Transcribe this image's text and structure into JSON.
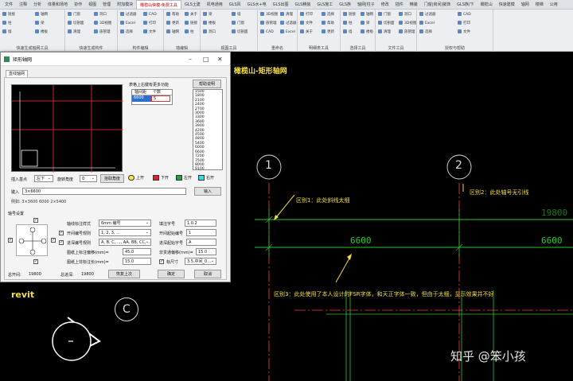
{
  "ribbon": {
    "tabs": [
      "文件",
      "注释",
      "分析",
      "体量和场地",
      "协作",
      "视图",
      "管理",
      "附加模块",
      "橄榄山快模-免费工具",
      "GLS土建",
      "机电通用",
      "GLS风",
      "GLS水+电",
      "GLS出图",
      "GLS精装",
      "GLS施工",
      "GLS族",
      "轴网|柱子",
      "修改",
      "插件",
      "精装",
      "门窗|房间|装饰",
      "GLS族/下",
      "橄榄山",
      "快速建模",
      "轴网",
      "楼梯",
      "公用"
    ],
    "active_tab": "橄榄山快模-免费工具",
    "panels": [
      "快速生成轴网工具",
      "快速生成构件",
      "构件编辑",
      "墙编辑",
      "视图工具",
      "重命名",
      "明细表工具",
      "选择工具",
      "文件工具",
      "授权与帮助"
    ],
    "buttons": [
      "链接",
      "轴网",
      "柱",
      "梁",
      "墙",
      "楼板",
      "门窗",
      "洞口",
      "切剖面",
      "3D视图",
      "清理",
      "族管理",
      "过滤器",
      "CAD",
      "Excel",
      "打印",
      "选择",
      "文件",
      "帮助",
      "关于",
      "更新"
    ]
  },
  "dialog": {
    "title": "矩形轴网",
    "tab": "直线轴网",
    "hint": "表格上右键有更多功能",
    "help_button": "帮助说明",
    "table_headers": [
      "轴间距",
      "个数"
    ],
    "table_row": [
      "6600",
      "5"
    ],
    "spacing_list": [
      "1500",
      "1800",
      "2100",
      "2400",
      "2700",
      "3000",
      "3300",
      "3600",
      "3900",
      "4200",
      "4500",
      "4800",
      "5400",
      "6000",
      "6600",
      "7200",
      "7500",
      "8000",
      "9100"
    ],
    "insert_point_label": "插入基点",
    "insert_point_value": "左下",
    "rotate_label": "旋转角度",
    "rotate_value": "0",
    "pick_angle_button": "拾取角度",
    "dir_buttons": [
      "上开",
      "下开",
      "左开",
      "右开"
    ],
    "input_label": "键入",
    "input_value": "3×6600",
    "confirm_button": "输入",
    "example_label": "例如: 3×3600 6000 2×5400",
    "axis_section": "轴号设置",
    "style_label": "轴线标注样式",
    "style_value": "6mm 编号",
    "rule_label": "开间编号规则",
    "rule_value": "1, 2, 3, ...",
    "rule2_label": "进深编号规则",
    "rule2_value": "A, B, C, ..., AA, BB, CC, ...",
    "up_dim_label": "图纸上标注偏移(mm)=",
    "up_dim_value": "45.0",
    "down_dim_label": "图纸上非标注长(mm)=",
    "down_dim_value": "15.0",
    "font_label": "填注字号",
    "font_value": "1.0.2",
    "start_label": "开间起始编号",
    "start_value": "1",
    "start2_label": "进深起始字号",
    "start2_value": "A",
    "offset_label": "非贯通偏移(mm)=",
    "offset_value": "15.0",
    "size_label": "标尺寸",
    "size_value": "3.5.中间_0...",
    "total_w_label": "总开间:",
    "total_w_value": "19800",
    "total_d_label": "总进深:",
    "total_d_value": "19800",
    "restore_button": "恢复上次",
    "ok_button": "确定",
    "cancel_button": "取消"
  },
  "cad": {
    "title": "橄榄山-矩形轴网",
    "axis1": "1",
    "axis2": "2",
    "axisC": "C",
    "dim_total": "19800",
    "dim_a": "6600",
    "dim_b": "6600",
    "note1": "区别1：此处斜线太细",
    "note2": "区别2：此处轴号无引线",
    "note3": "区别3：此处使用了本人设计的FSR字体，和天正字体一致，但由于太细，显示效果并不好",
    "revit": "revit",
    "watermark": "知乎 @笨小孩"
  },
  "colors": {
    "annotation": "#f5e03a",
    "axis": "#ff3b3b",
    "dim": "#2ec62e",
    "title": "#f5e03a"
  }
}
